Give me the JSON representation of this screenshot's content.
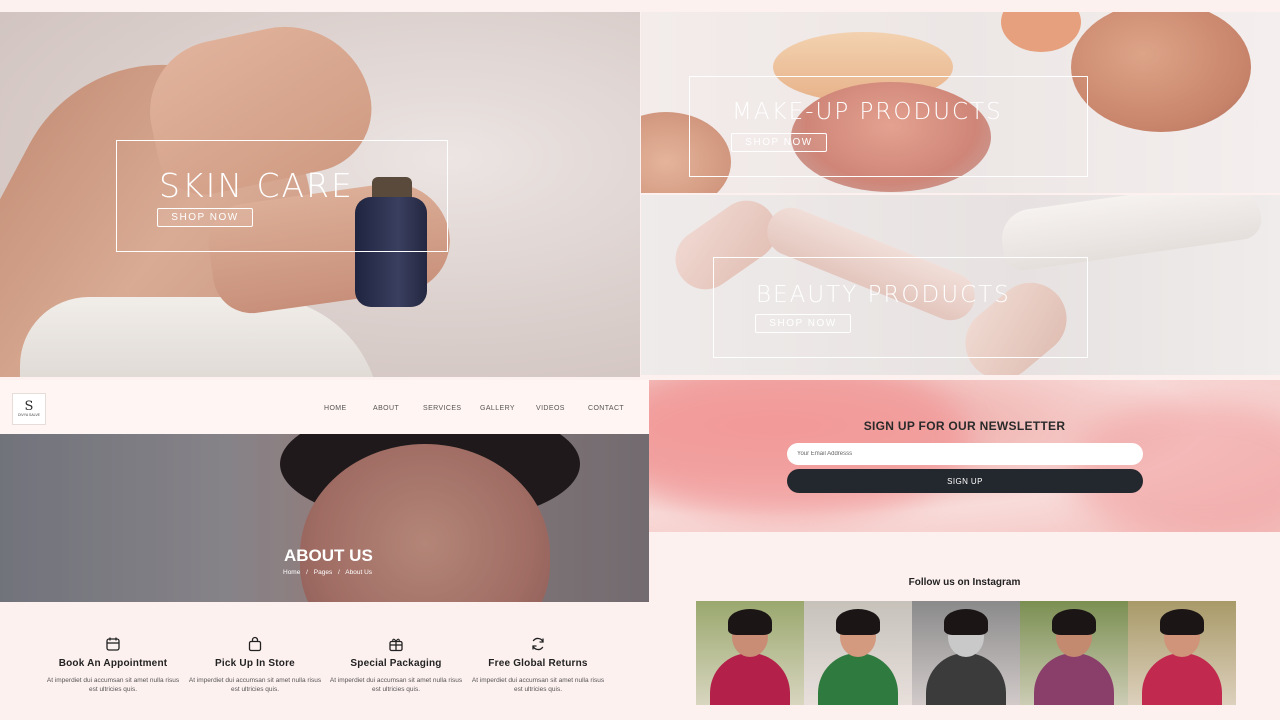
{
  "hero": {
    "skin_care": {
      "title": "SKIN CARE",
      "cta": "SHOP NOW"
    },
    "makeup": {
      "title": "MAKE-UP PRODUCTS",
      "cta": "SHOP NOW"
    },
    "beauty": {
      "title": "BEAUTY PRODUCTS",
      "cta": "SHOP NOW"
    }
  },
  "navbar": {
    "logo": {
      "mark": "S",
      "text": "DIVYA SALVE"
    },
    "links": [
      "HOME",
      "ABOUT",
      "SERVICES",
      "GALLERY",
      "VIDEOS",
      "CONTACT"
    ]
  },
  "about_banner": {
    "title": "ABOUT US",
    "breadcrumb": [
      "Home",
      "/",
      "Pages",
      "/",
      "About Us"
    ]
  },
  "features": [
    {
      "icon": "calendar-icon",
      "title": "Book An Appointment",
      "desc": "At imperdiet dui accumsan sit amet nulla risus est ultricies quis."
    },
    {
      "icon": "shopping-bag-icon",
      "title": "Pick Up In Store",
      "desc": "At imperdiet dui accumsan sit amet nulla risus est ultricies quis."
    },
    {
      "icon": "gift-icon",
      "title": "Special Packaging",
      "desc": "At imperdiet dui accumsan sit amet nulla risus est ultricies quis."
    },
    {
      "icon": "refresh-icon",
      "title": "Free Global Returns",
      "desc": "At imperdiet dui accumsan sit amet nulla risus est ultricies quis."
    }
  ],
  "newsletter": {
    "title": "SIGN UP FOR OUR NEWSLETTER",
    "placeholder": "Your Email Addresss",
    "button": "SIGN UP"
  },
  "instagram": {
    "title": "Follow us on Instagram",
    "images": [
      {
        "name": "insta-photo-1",
        "bg": "#9aa86e",
        "skin": "#c98c75",
        "cloth": "#b3204a"
      },
      {
        "name": "insta-photo-2",
        "bg": "#c6c2ba",
        "skin": "#d39a80",
        "cloth": "#2f7a3f"
      },
      {
        "name": "insta-photo-3",
        "bg": "#8a8a8a",
        "skin": "#c9c9c9",
        "cloth": "#3b3b3b"
      },
      {
        "name": "insta-photo-4",
        "bg": "#7b8f52",
        "skin": "#c48a70",
        "cloth": "#8a3f6a"
      },
      {
        "name": "insta-photo-5",
        "bg": "#a89a68",
        "skin": "#cf9479",
        "cloth": "#c2294f"
      }
    ]
  },
  "colors": {
    "page_bg": "#fdf1f0",
    "button_dark": "#23272e",
    "text_dark": "#222222"
  }
}
